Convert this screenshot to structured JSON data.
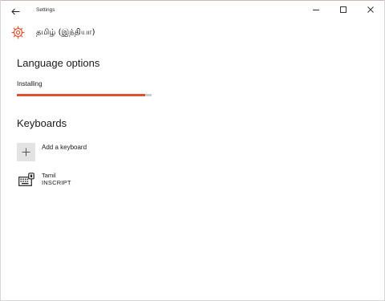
{
  "window": {
    "title": "Settings",
    "controls": [
      "minimize-icon",
      "maximize-icon",
      "close-icon"
    ],
    "accent_color": "#d0b4b4"
  },
  "header": {
    "icon": "gear-icon",
    "icon_color": "#e0522b",
    "heading": "தமிழ் (இந்தியா)"
  },
  "language_options": {
    "title": "Language options",
    "status": "Installing",
    "progress": 0.95,
    "progress_color": "#e0522b"
  },
  "keyboards": {
    "title": "Keyboards",
    "add_label": "Add a keyboard",
    "items": [
      {
        "icon": "keyboard-icon",
        "name": "Tamil",
        "layout": "INSCRIPT"
      }
    ]
  }
}
